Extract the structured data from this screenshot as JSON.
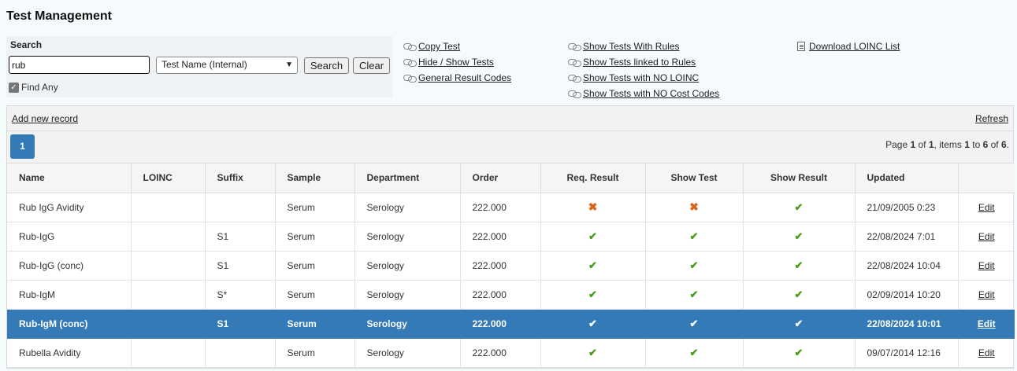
{
  "page": {
    "title": "Test Management"
  },
  "search": {
    "label": "Search",
    "query": "rub",
    "field_selected": "Test Name (Internal)",
    "search_button": "Search",
    "clear_button": "Clear",
    "find_any_label": "Find Any",
    "find_any_checked": true
  },
  "links": {
    "col1": [
      "Copy Test",
      "Hide / Show Tests",
      "General Result Codes"
    ],
    "col2": [
      "Show Tests With Rules",
      "Show Tests linked to Rules",
      "Show Tests with NO LOINC",
      "Show Tests with NO Cost Codes"
    ],
    "col3": [
      "Download LOINC List"
    ]
  },
  "grid": {
    "add_record": "Add new record",
    "refresh": "Refresh",
    "current_page": "1",
    "pager": {
      "page": "1",
      "of": "1",
      "from": "1",
      "to": "6",
      "total": "6"
    },
    "columns": [
      "Name",
      "LOINC",
      "Suffix",
      "Sample",
      "Department",
      "Order",
      "Req. Result",
      "Show Test",
      "Show Result",
      "Updated",
      ""
    ],
    "edit_label": "Edit",
    "rows": [
      {
        "name": "Rub IgG Avidity",
        "loinc": "",
        "suffix": "",
        "sample": "Serum",
        "department": "Serology",
        "order": "222.000",
        "req_result": false,
        "show_test": false,
        "show_result": true,
        "updated": "21/09/2005 0:23",
        "selected": false
      },
      {
        "name": "Rub-IgG",
        "loinc": "",
        "suffix": "S1",
        "sample": "Serum",
        "department": "Serology",
        "order": "222.000",
        "req_result": true,
        "show_test": true,
        "show_result": true,
        "updated": "22/08/2024 7:01",
        "selected": false
      },
      {
        "name": "Rub-IgG (conc)",
        "loinc": "",
        "suffix": "S1",
        "sample": "Serum",
        "department": "Serology",
        "order": "222.000",
        "req_result": true,
        "show_test": true,
        "show_result": true,
        "updated": "22/08/2024 10:04",
        "selected": false
      },
      {
        "name": "Rub-IgM",
        "loinc": "",
        "suffix": "S*",
        "sample": "Serum",
        "department": "Serology",
        "order": "222.000",
        "req_result": true,
        "show_test": true,
        "show_result": true,
        "updated": "02/09/2014 10:20",
        "selected": false
      },
      {
        "name": "Rub-IgM (conc)",
        "loinc": "",
        "suffix": "S1",
        "sample": "Serum",
        "department": "Serology",
        "order": "222.000",
        "req_result": true,
        "show_test": true,
        "show_result": true,
        "updated": "22/08/2024 10:01",
        "selected": true
      },
      {
        "name": "Rubella Avidity",
        "loinc": "",
        "suffix": "",
        "sample": "Serum",
        "department": "Serology",
        "order": "222.000",
        "req_result": true,
        "show_test": true,
        "show_result": true,
        "updated": "09/07/2014 12:16",
        "selected": false
      }
    ]
  },
  "colors": {
    "accent": "#337ab7",
    "check": "#4a9b1c",
    "cross": "#d9661b"
  },
  "icons": {
    "link": "chain-link-icon",
    "download": "document-icon",
    "yes": "check-icon",
    "no": "cross-icon"
  }
}
